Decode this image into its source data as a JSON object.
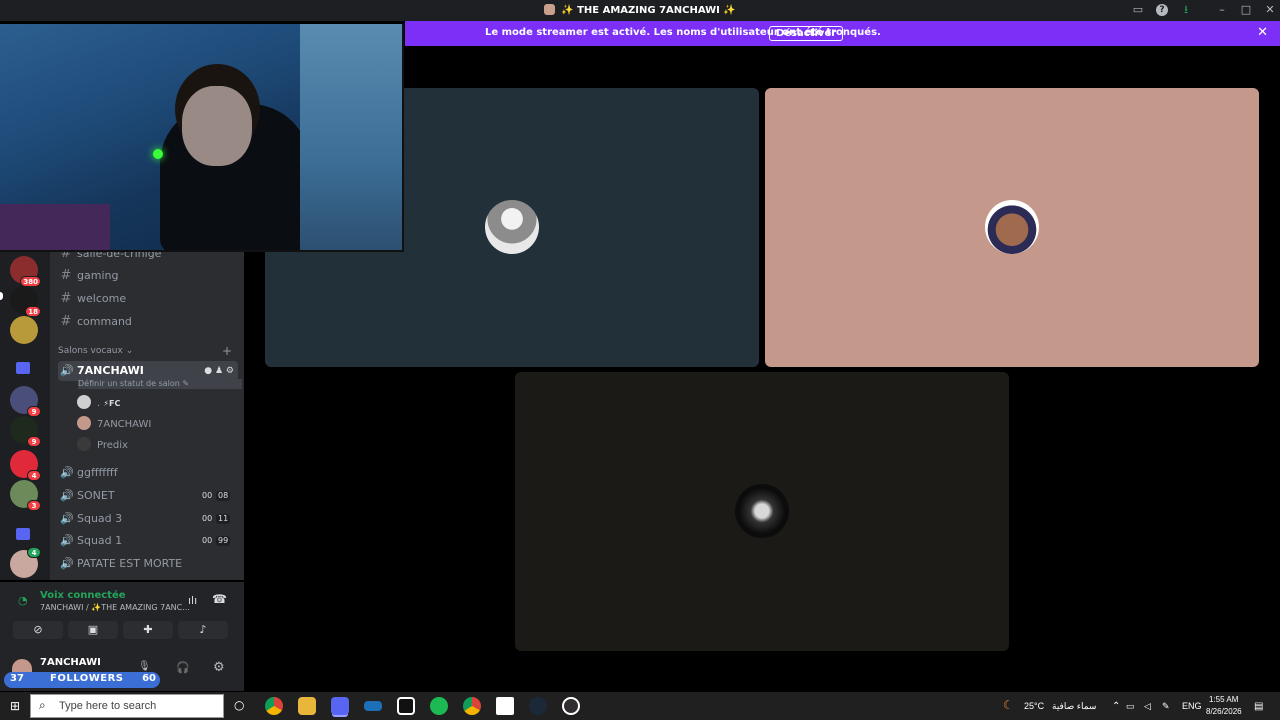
{
  "window": {
    "title": "THE AMAZING 7ANCHAWI",
    "title_prefix": "✨",
    "title_suffix": "✨"
  },
  "banner": {
    "message": "Le mode streamer est activé. Les noms d'utilisateur ont été tronqués.",
    "button_label": "Désactiver"
  },
  "servers": [
    {
      "badge": "380"
    },
    {
      "badge": "18"
    },
    {
      "badge": ""
    },
    {
      "badge": "9"
    },
    {
      "badge": "9"
    },
    {
      "badge": "4"
    },
    {
      "badge": "3"
    },
    {
      "badge": "4"
    }
  ],
  "text_channels": [
    {
      "name": "salle-de-crinige"
    },
    {
      "name": "gaming"
    },
    {
      "name": "welcome"
    },
    {
      "name": "command"
    }
  ],
  "voice_section": {
    "label": "Salons vocaux",
    "add_symbol": "+"
  },
  "voice_channels": {
    "active": {
      "name": "7ANCHAWI",
      "status_hint": "Définir un statut de salon",
      "members": [
        {
          "name": "⚡FC",
          "prefix": "."
        },
        {
          "name": "7ANCHAWI"
        },
        {
          "name": "Predix"
        }
      ]
    },
    "others": [
      {
        "name": "ggfffffff",
        "count_a": "",
        "count_b": ""
      },
      {
        "name": "SONET",
        "count_a": "00",
        "count_b": "08"
      },
      {
        "name": "Squad 3",
        "count_a": "00",
        "count_b": "11"
      },
      {
        "name": "Squad 1",
        "count_a": "00",
        "count_b": "99"
      },
      {
        "name": "PATATE EST MORTE",
        "count_a": "",
        "count_b": ""
      }
    ]
  },
  "voice_panel": {
    "status": "Voix connectée",
    "location": "7ANCHAWI / ✨THE AMAZING 7ANC..."
  },
  "user": {
    "name": "7ANCHAWI"
  },
  "followers_widget": {
    "current": "37",
    "label": "FOLLOWERS",
    "goal": "60"
  },
  "taskbar": {
    "search_placeholder": "Type here to search",
    "weather": "25°C",
    "weather_desc": "سماء صافية",
    "language": "ENG",
    "time": "1:55 AM",
    "date": "8/26/2026"
  },
  "colors": {
    "banner": "#7b2ff7",
    "tile_1": "#22303a",
    "tile_2": "#c4988a",
    "tile_3": "#1b1a17",
    "voice_connected": "#23a55a"
  }
}
